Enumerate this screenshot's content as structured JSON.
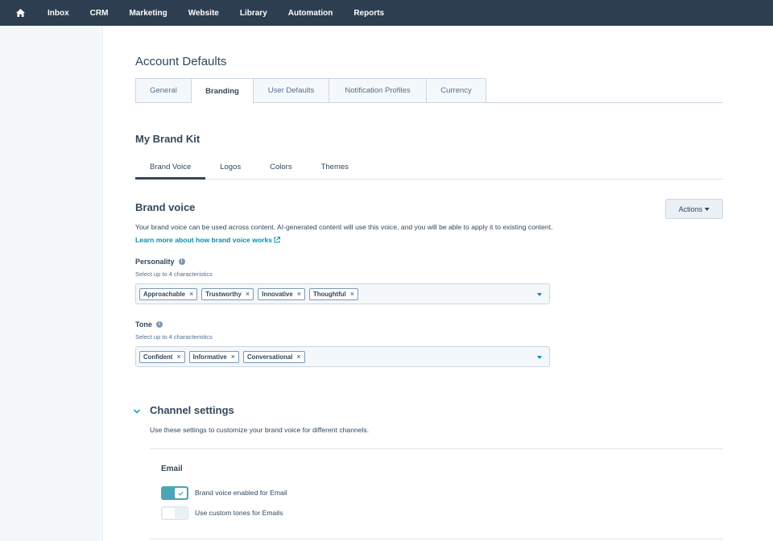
{
  "nav": {
    "home_icon": "home-icon",
    "items": [
      "Inbox",
      "CRM",
      "Marketing",
      "Website",
      "Library",
      "Automation",
      "Reports"
    ]
  },
  "page": {
    "title": "Account Defaults"
  },
  "tabs": [
    {
      "label": "General",
      "active": false
    },
    {
      "label": "Branding",
      "active": true
    },
    {
      "label": "User Defaults",
      "active": false
    },
    {
      "label": "Notification Profiles",
      "active": false
    },
    {
      "label": "Currency",
      "active": false
    }
  ],
  "brand_kit": {
    "title": "My Brand Kit",
    "subtabs": [
      {
        "label": "Brand Voice",
        "active": true
      },
      {
        "label": "Logos",
        "active": false
      },
      {
        "label": "Colors",
        "active": false
      },
      {
        "label": "Themes",
        "active": false
      }
    ]
  },
  "brand_voice": {
    "title": "Brand voice",
    "actions_label": "Actions",
    "description": "Your brand voice can be used across content. AI-generated content will use this voice, and you will be able to apply it to existing content.",
    "learn_more": "Learn more about how brand voice works"
  },
  "personality": {
    "label": "Personality",
    "hint": "Select up to 4 characteristics",
    "tags": [
      "Approachable",
      "Trustworthy",
      "Innovative",
      "Thoughtful"
    ]
  },
  "tone": {
    "label": "Tone",
    "hint": "Select up to 4 characteristics",
    "tags": [
      "Confident",
      "Informative",
      "Conversational"
    ]
  },
  "channel_settings": {
    "title": "Channel settings",
    "description": "Use these settings to customize your brand voice for different channels.",
    "email": {
      "title": "Email",
      "toggles": [
        {
          "label": "Brand voice enabled for Email",
          "on": true
        },
        {
          "label": "Use custom tones for Emails",
          "on": false
        }
      ]
    }
  },
  "colors": {
    "nav_bg": "#2d3e50",
    "accent": "#0091ae",
    "toggle_on": "#4aa5b8"
  }
}
